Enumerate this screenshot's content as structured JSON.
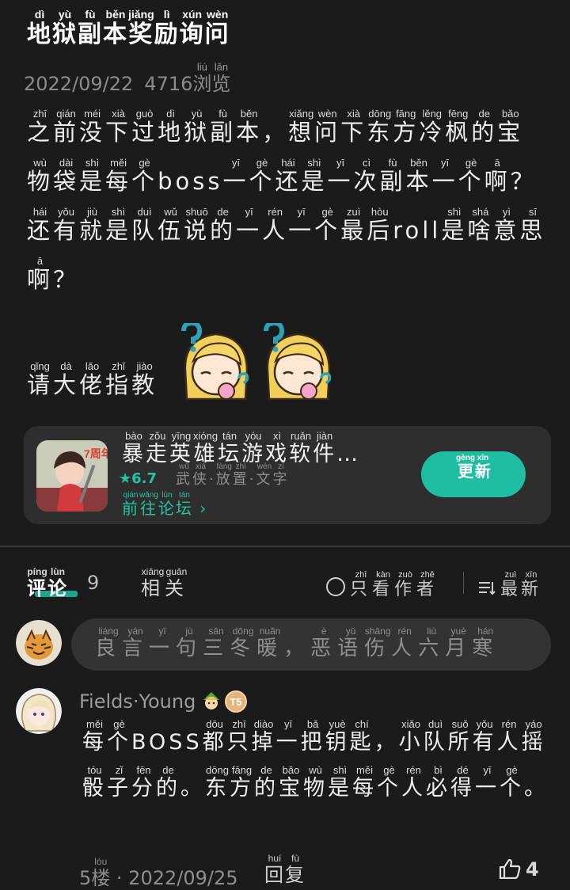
{
  "post": {
    "title": [
      [
        "地",
        "dì"
      ],
      [
        "狱",
        "yù"
      ],
      [
        "副",
        "fù"
      ],
      [
        "本",
        "běn"
      ],
      [
        "奖",
        "jiǎng"
      ],
      [
        "励",
        "lì"
      ],
      [
        "询",
        "xún"
      ],
      [
        "问",
        "wèn"
      ]
    ],
    "date": "2022/09/22",
    "views": "4716",
    "views_suffix": [
      [
        "浏",
        "liú"
      ],
      [
        "览",
        "lǎn"
      ]
    ],
    "body": [
      [
        "之",
        "zhī"
      ],
      [
        "前",
        "qián"
      ],
      [
        "没",
        "méi"
      ],
      [
        "下",
        "xià"
      ],
      [
        "过",
        "guò"
      ],
      [
        "地",
        "dì"
      ],
      [
        "狱",
        "yù"
      ],
      [
        "副",
        "fù"
      ],
      [
        "本",
        "běn"
      ],
      [
        "，",
        ""
      ],
      [
        "想",
        "xiǎng"
      ],
      [
        "问",
        "wèn"
      ],
      [
        "下",
        "xià"
      ],
      [
        "东",
        "dōng"
      ],
      [
        "方",
        "fāng"
      ],
      [
        "冷",
        "lěng"
      ],
      [
        "枫",
        "fēng"
      ],
      [
        "的",
        "de"
      ],
      [
        "宝",
        "bǎo"
      ],
      [
        "物",
        "wù"
      ],
      [
        "袋",
        "dài"
      ],
      [
        "是",
        "shì"
      ],
      [
        "每",
        "měi"
      ],
      [
        "个",
        "gè"
      ],
      [
        "boss",
        ""
      ],
      [
        "一",
        "yī"
      ],
      [
        "个",
        "gè"
      ],
      [
        "还",
        "hái"
      ],
      [
        "是",
        "shì"
      ],
      [
        "一",
        "yī"
      ],
      [
        "次",
        "cì"
      ],
      [
        "副",
        "fù"
      ],
      [
        "本",
        "běn"
      ],
      [
        "一",
        "yī"
      ],
      [
        "个",
        "gè"
      ],
      [
        "啊",
        "ā"
      ],
      [
        "？",
        ""
      ],
      [
        "还",
        "hái"
      ],
      [
        "有",
        "yǒu"
      ],
      [
        "就",
        "jiù"
      ],
      [
        "是",
        "shì"
      ],
      [
        "队",
        "duì"
      ],
      [
        "伍",
        "wǔ"
      ],
      [
        "说",
        "shuō"
      ],
      [
        "的",
        "de"
      ],
      [
        "一",
        "yī"
      ],
      [
        "人",
        "rén"
      ],
      [
        "一",
        "yī"
      ],
      [
        "个",
        "gè"
      ],
      [
        "最",
        "zuì"
      ],
      [
        "后",
        "hòu"
      ],
      [
        "roll",
        ""
      ],
      [
        "是",
        "shì"
      ],
      [
        "啥",
        "shá"
      ],
      [
        "意",
        "yì"
      ],
      [
        "思",
        "sī"
      ],
      [
        "啊",
        "ā"
      ],
      [
        "？",
        ""
      ]
    ],
    "ask": [
      [
        "请",
        "qǐng"
      ],
      [
        "大",
        "dà"
      ],
      [
        "佬",
        "lǎo"
      ],
      [
        "指",
        "zhǐ"
      ],
      [
        "教",
        "jiào"
      ]
    ]
  },
  "app_card": {
    "name": [
      [
        "暴",
        "bào"
      ],
      [
        "走",
        "zǒu"
      ],
      [
        "英",
        "yīng"
      ],
      [
        "雄",
        "xióng"
      ],
      [
        "坛",
        "tán"
      ],
      [
        "游",
        "yóu"
      ],
      [
        "戏",
        "xì"
      ],
      [
        "软",
        "ruǎn"
      ],
      [
        "件",
        "jiàn"
      ],
      [
        "…",
        ""
      ]
    ],
    "icon_badge": "7周年",
    "rating": "★6.7",
    "tags": [
      [
        "武",
        "wǔ"
      ],
      [
        "侠",
        "xiá"
      ],
      [
        "·",
        ""
      ],
      [
        "放",
        "fàng"
      ],
      [
        "置",
        "zhì"
      ],
      [
        "·",
        ""
      ],
      [
        "文",
        "wén"
      ],
      [
        "字",
        "zì"
      ]
    ],
    "goto": [
      [
        "前",
        "qián"
      ],
      [
        "往",
        "wǎng"
      ],
      [
        "论",
        "lùn"
      ],
      [
        "坛",
        "tán"
      ],
      [
        " ›",
        ""
      ]
    ],
    "update": [
      [
        "更",
        "gèng"
      ],
      [
        "新",
        "xīn"
      ]
    ]
  },
  "tabs": {
    "comment": [
      [
        "评",
        "píng"
      ],
      [
        "论",
        "lùn"
      ]
    ],
    "comment_count": "9",
    "related": [
      [
        "相",
        "xiāng"
      ],
      [
        "关",
        "guān"
      ]
    ],
    "author_only": [
      [
        "只",
        "zhī"
      ],
      [
        "看",
        "kàn"
      ],
      [
        "作",
        "zuò"
      ],
      [
        "者",
        "zhě"
      ]
    ],
    "newest": [
      [
        "最",
        "zuì"
      ],
      [
        "新",
        "xīn"
      ]
    ]
  },
  "input": {
    "placeholder": [
      [
        "良",
        "liáng"
      ],
      [
        "言",
        "yán"
      ],
      [
        "一",
        "yī"
      ],
      [
        "句",
        "jù"
      ],
      [
        "三",
        "sān"
      ],
      [
        "冬",
        "dōng"
      ],
      [
        "暖",
        "nuǎn"
      ],
      [
        "，",
        ""
      ],
      [
        "恶",
        "è"
      ],
      [
        "语",
        "yǔ"
      ],
      [
        "伤",
        "shāng"
      ],
      [
        "人",
        "rén"
      ],
      [
        "六",
        "liù"
      ],
      [
        "月",
        "yuè"
      ],
      [
        "寒",
        "hán"
      ]
    ]
  },
  "reply": {
    "username": "Fields·Young",
    "badge2_text": "T5",
    "body": [
      [
        "每",
        "měi"
      ],
      [
        "个",
        "gè"
      ],
      [
        "BOSS",
        ""
      ],
      [
        "都",
        "dōu"
      ],
      [
        "只",
        "zhī"
      ],
      [
        "掉",
        "diào"
      ],
      [
        "一",
        "yī"
      ],
      [
        "把",
        "bǎ"
      ],
      [
        "钥",
        "yuè"
      ],
      [
        "匙",
        "chí"
      ],
      [
        "，",
        ""
      ],
      [
        "小",
        "xiǎo"
      ],
      [
        "队",
        "duì"
      ],
      [
        "所",
        "suǒ"
      ],
      [
        "有",
        "yǒu"
      ],
      [
        "人",
        "rén"
      ],
      [
        "摇",
        "yáo"
      ],
      [
        "骰",
        "tóu"
      ],
      [
        "子",
        "zǐ"
      ],
      [
        "分",
        "fēn"
      ],
      [
        "的",
        "de"
      ],
      [
        "。",
        ""
      ],
      [
        "东",
        "dōng"
      ],
      [
        "方",
        "fāng"
      ],
      [
        "的",
        "de"
      ],
      [
        "宝",
        "bǎo"
      ],
      [
        "物",
        "wù"
      ],
      [
        "是",
        "shì"
      ],
      [
        "每",
        "měi"
      ],
      [
        "个",
        "gè"
      ],
      [
        "人",
        "rén"
      ],
      [
        "必",
        "bì"
      ],
      [
        "得",
        "dé"
      ],
      [
        "一",
        "yī"
      ],
      [
        "个",
        "gè"
      ],
      [
        "。",
        ""
      ]
    ],
    "floor": "5",
    "floor_suffix": [
      [
        "楼",
        "lóu"
      ]
    ],
    "date": "· 2022/09/25",
    "reply_label": [
      [
        "回",
        "huí"
      ],
      [
        "复",
        "fù"
      ]
    ],
    "likes": "4"
  },
  "colors": {
    "accent": "#1fbda1",
    "background": "#1b1b1b",
    "card": "#2e2e2e"
  }
}
